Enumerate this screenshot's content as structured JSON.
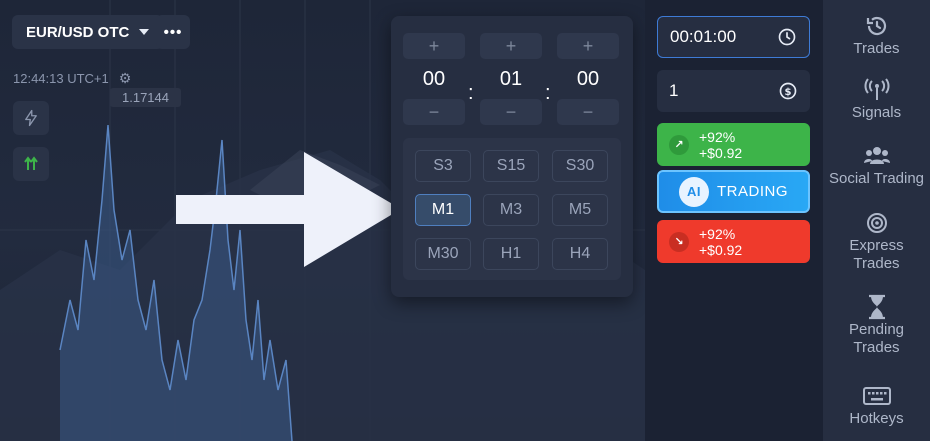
{
  "header": {
    "pair_label": "EUR/USD OTC",
    "more_label": "•••"
  },
  "chart": {
    "clock": "12:44:13 UTC+1",
    "price_tag": "1.17144"
  },
  "picker": {
    "increment_label": "+",
    "decrement_label": "−",
    "separator": ":",
    "hours": "00",
    "minutes": "01",
    "seconds": "00",
    "timeframes": [
      "S3",
      "S15",
      "S30",
      "M1",
      "M3",
      "M5",
      "M30",
      "H1",
      "H4"
    ],
    "selected_timeframe": "M1"
  },
  "trade_panel": {
    "time_value": "00:01:00",
    "amount_value": "1",
    "up": {
      "percent": "+92%",
      "profit": "+$0.92"
    },
    "down": {
      "percent": "+92%",
      "profit": "+$0.92"
    },
    "ai_badge": "AI",
    "ai_label": "TRADING"
  },
  "sidebar": {
    "items": [
      {
        "label": "Trades",
        "icon": "history-icon"
      },
      {
        "label": "Signals",
        "icon": "signal-tower-icon"
      },
      {
        "label": "Social Trading",
        "icon": "users-icon"
      },
      {
        "label": "Express\nTrades",
        "icon": "target-icon"
      },
      {
        "label": "Pending\nTrades",
        "icon": "hourglass-icon"
      },
      {
        "label": "Hotkeys",
        "icon": "keyboard-icon"
      }
    ]
  },
  "colors": {
    "up": "#3db449",
    "down": "#ef3a2c",
    "ai": "#1f8de8",
    "accent_focus": "#3e7bd6"
  }
}
